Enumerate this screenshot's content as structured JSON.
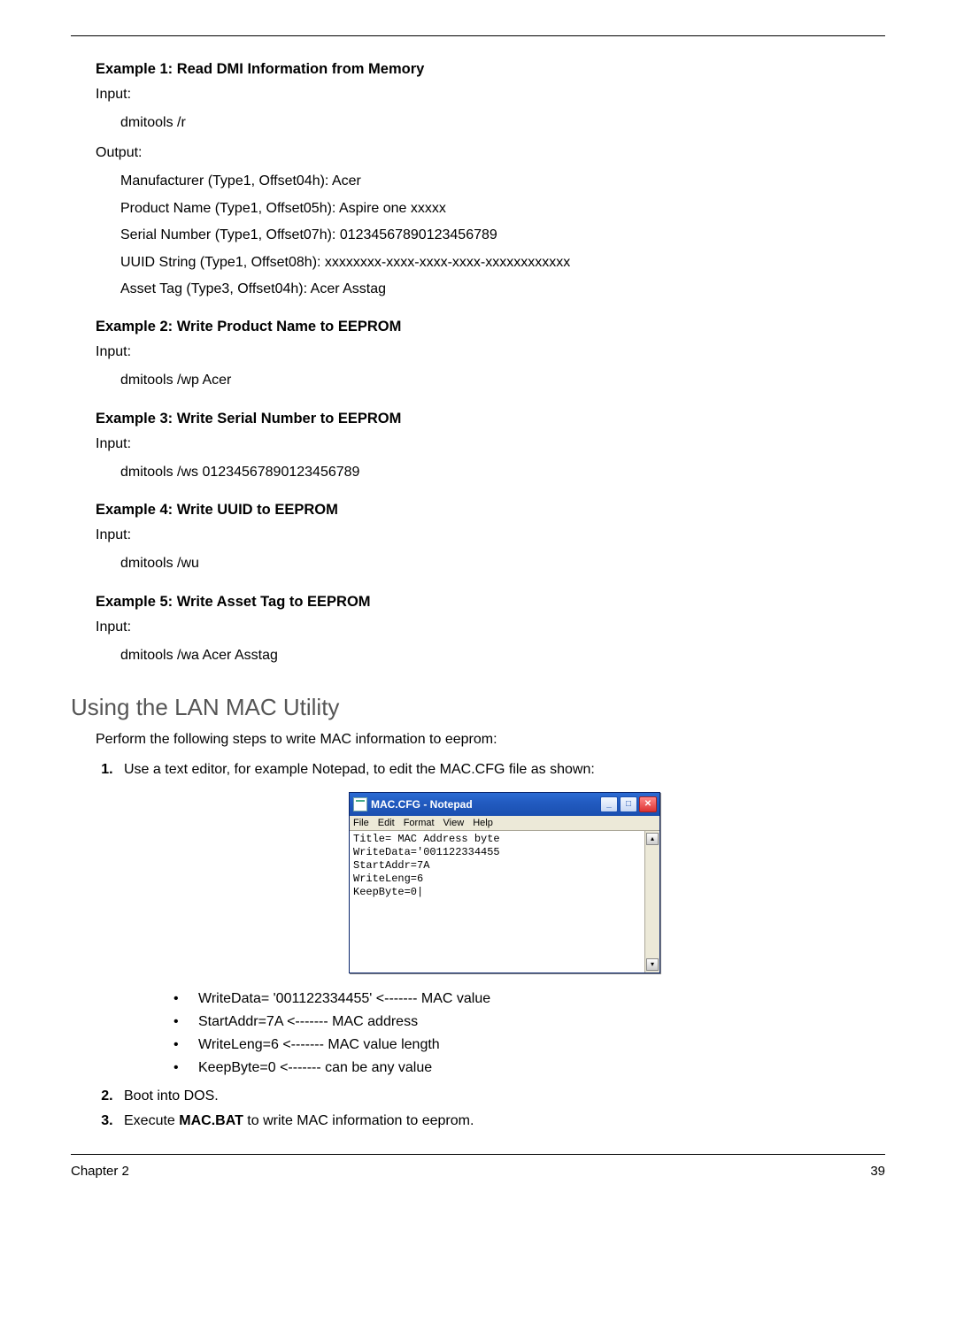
{
  "examples": [
    {
      "title": "Example 1: Read DMI Information from Memory",
      "input_label": "Input:",
      "input_cmd": "dmitools /r",
      "output_label": "Output:",
      "output_lines": [
        "Manufacturer (Type1, Offset04h): Acer",
        "Product Name (Type1, Offset05h): Aspire one xxxxx",
        "Serial Number (Type1, Offset07h): 01234567890123456789",
        "UUID String (Type1, Offset08h): xxxxxxxx-xxxx-xxxx-xxxx-xxxxxxxxxxxx",
        "Asset Tag (Type3, Offset04h): Acer Asstag"
      ]
    },
    {
      "title": "Example 2: Write Product Name to EEPROM",
      "input_label": "Input:",
      "input_cmd": "dmitools /wp Acer"
    },
    {
      "title": "Example 3: Write Serial Number to EEPROM",
      "input_label": "Input:",
      "input_cmd": "dmitools /ws 01234567890123456789"
    },
    {
      "title": "Example 4: Write UUID to EEPROM",
      "input_label": "Input:",
      "input_cmd": "dmitools /wu"
    },
    {
      "title": "Example 5: Write Asset Tag to EEPROM",
      "input_label": "Input:",
      "input_cmd": "dmitools /wa Acer Asstag"
    }
  ],
  "section_heading": "Using the LAN MAC Utility",
  "intro_text": "Perform the following steps to write MAC information to eeprom:",
  "step1_text": "Use a text editor, for example Notepad, to edit the MAC.CFG file as shown:",
  "notepad": {
    "window_title": "MAC.CFG - Notepad",
    "menu": [
      "File",
      "Edit",
      "Format",
      "View",
      "Help"
    ],
    "content": "Title= MAC Address byte\nWriteData='001122334455\nStartAddr=7A\nWriteLeng=6\nKeepByte=0|"
  },
  "sublist": [
    "WriteData= '001122334455' <------- MAC value",
    "StartAddr=7A <------- MAC address",
    "WriteLeng=6 <------- MAC value length",
    "KeepByte=0 <------- can be any value"
  ],
  "step2_text": "Boot into DOS.",
  "step3_pre": "Execute ",
  "step3_bold": "MAC.BAT",
  "step3_post": " to write MAC information to eeprom.",
  "footer_left": "Chapter 2",
  "footer_right": "39"
}
